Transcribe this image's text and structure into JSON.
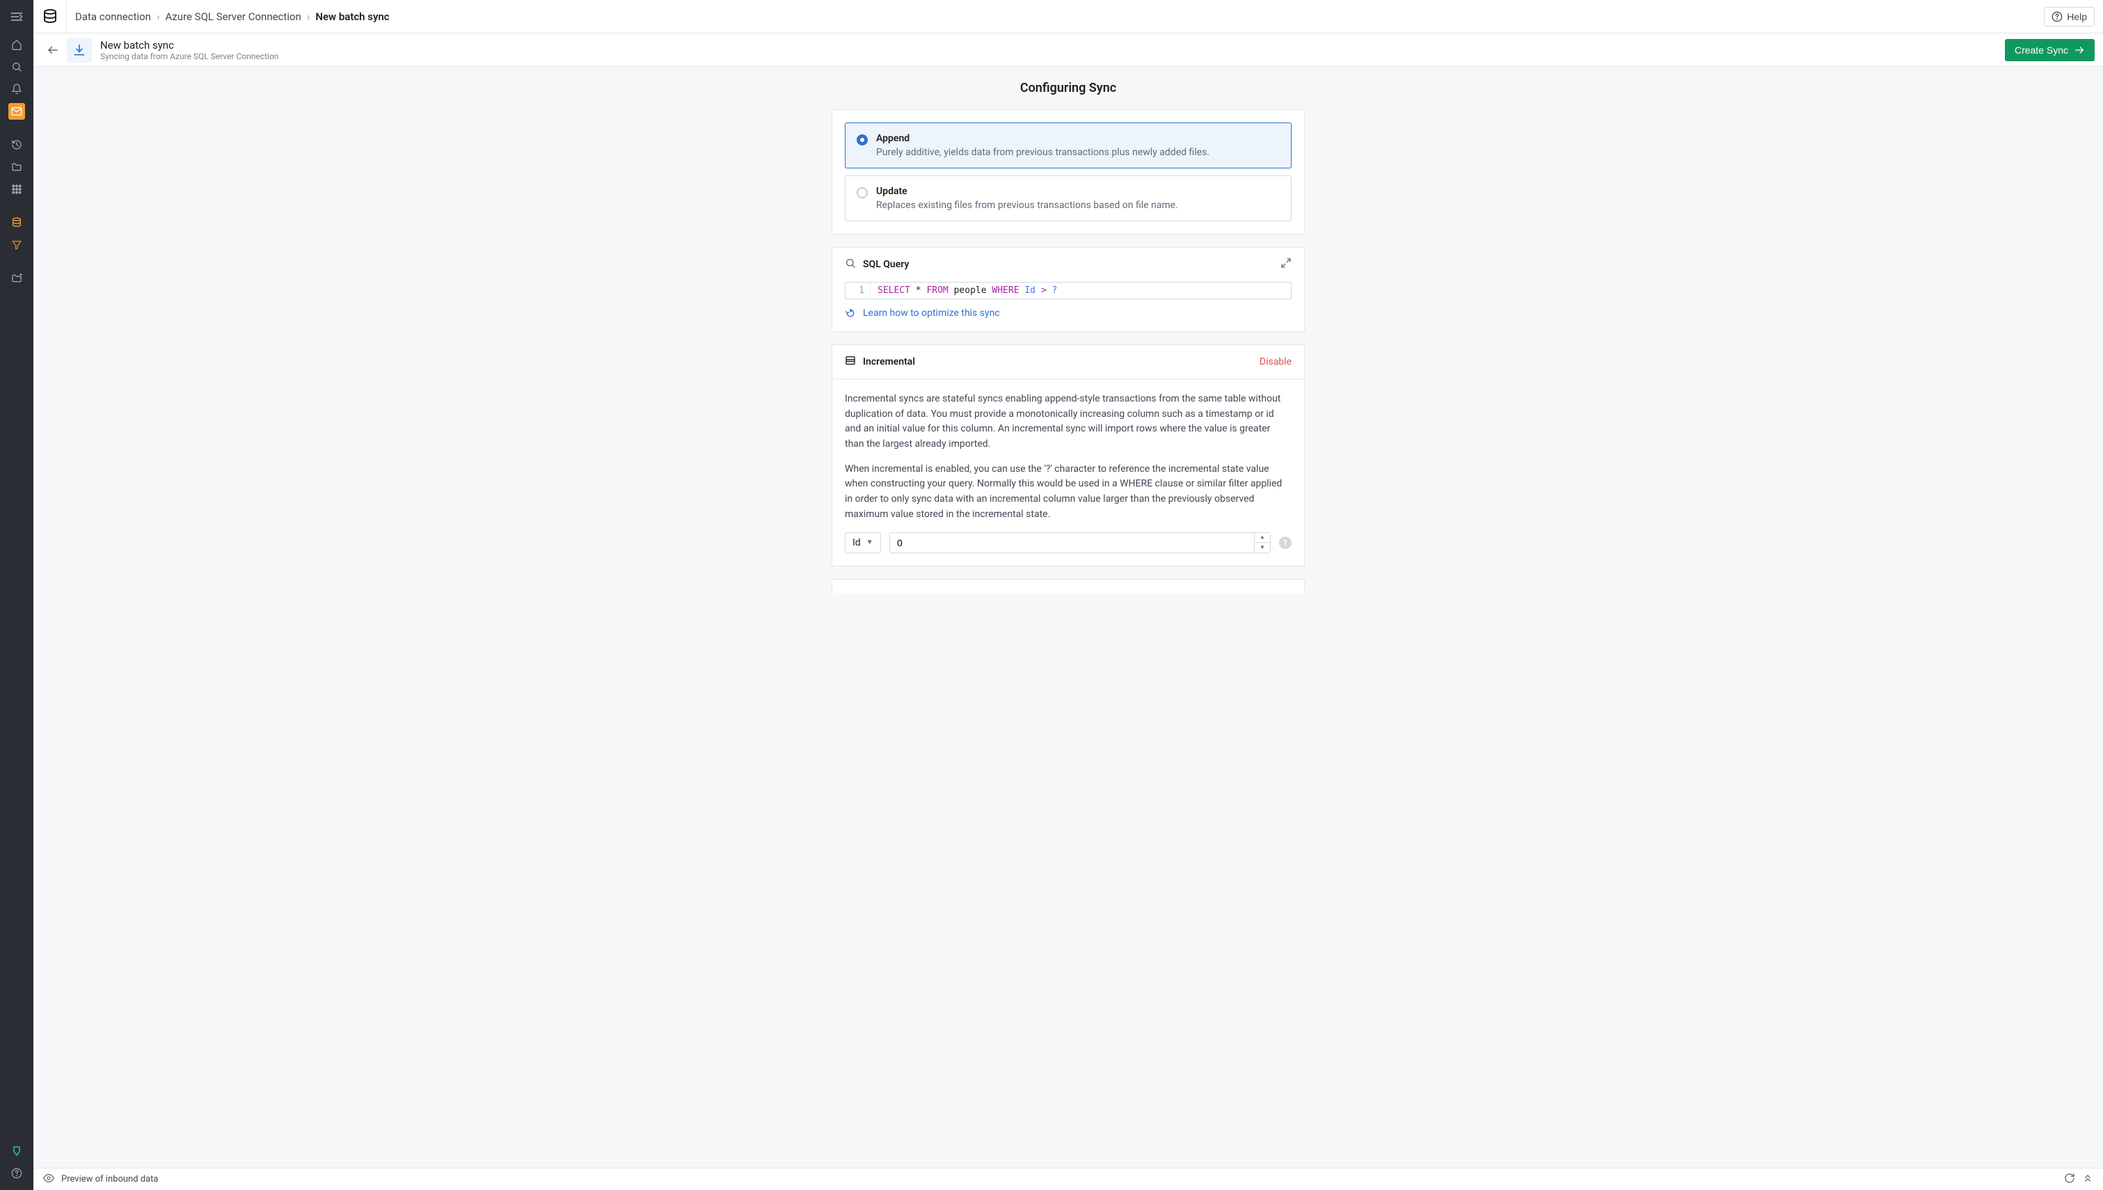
{
  "breadcrumbs": {
    "items": [
      "Data connection",
      "Azure SQL Server Connection",
      "New batch sync"
    ],
    "help_label": "Help"
  },
  "secondbar": {
    "title": "New batch sync",
    "subtitle": "Syncing data from Azure SQL Server Connection",
    "create_label": "Create Sync"
  },
  "page": {
    "title": "Configuring Sync"
  },
  "sync_mode": {
    "options": [
      {
        "key": "append",
        "title": "Append",
        "desc": "Purely additive, yields data from previous transactions plus newly added files.",
        "selected": true
      },
      {
        "key": "update",
        "title": "Update",
        "desc": "Replaces existing files from previous transactions based on file name.",
        "selected": false
      }
    ]
  },
  "sql": {
    "header": "SQL Query",
    "line_number": "1",
    "tokens": {
      "select": "SELECT",
      "star": " * ",
      "from": "FROM",
      "table": " people ",
      "where": "WHERE",
      "col": " Id ",
      "gt": ">",
      "qmark": " ?"
    },
    "optimize_label": "Learn how to optimize this sync"
  },
  "incremental": {
    "header": "Incremental",
    "disable_label": "Disable",
    "para1": "Incremental syncs are stateful syncs enabling append-style transactions from the same table without duplication of data. You must provide a monotonically increasing column such as a timestamp or id and an initial value for this column. An incremental sync will import rows where the value is greater than the largest already imported.",
    "para2": "When incremental is enabled, you can use the '?' character to reference the incremental state value when constructing your query. Normally this would be used in a WHERE clause or similar filter applied in order to only sync data with an incremental column value larger than the previously observed maximum value stored in the incremental state.",
    "column_select": "Id",
    "initial_value": "0"
  },
  "bottombar": {
    "preview_label": "Preview of inbound data"
  }
}
